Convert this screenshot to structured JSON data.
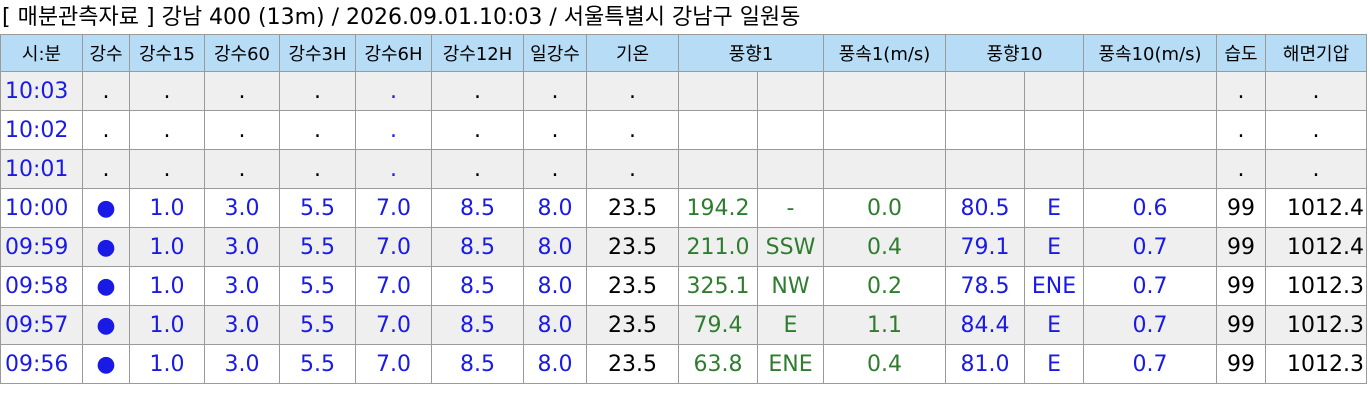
{
  "title": "[ 매분관측자료 ] 강남 400 (13m) / 2026.09.01.10:03 / 서울특별시 강남구 일원동",
  "headers": [
    "시:분",
    "강수",
    "강수15",
    "강수60",
    "강수3H",
    "강수6H",
    "강수12H",
    "일강수",
    "기온",
    "풍향1",
    "풍속1(m/s)",
    "풍향10",
    "풍속10(m/s)",
    "습도",
    "해면기압"
  ],
  "rows": [
    {
      "time": "10:03",
      "rain": ".",
      "r15": ".",
      "r60": ".",
      "r3h": ".",
      "r6h": ".",
      "r12h": ".",
      "day": ".",
      "temp": ".",
      "wd1": "",
      "wd1dir": "",
      "ws1": "",
      "wd10": "",
      "wd10dir": "",
      "ws10": "",
      "hum": ".",
      "press": "."
    },
    {
      "time": "10:02",
      "rain": ".",
      "r15": ".",
      "r60": ".",
      "r3h": ".",
      "r6h": ".",
      "r12h": ".",
      "day": ".",
      "temp": ".",
      "wd1": "",
      "wd1dir": "",
      "ws1": "",
      "wd10": "",
      "wd10dir": "",
      "ws10": "",
      "hum": ".",
      "press": "."
    },
    {
      "time": "10:01",
      "rain": ".",
      "r15": ".",
      "r60": ".",
      "r3h": ".",
      "r6h": ".",
      "r12h": ".",
      "day": ".",
      "temp": ".",
      "wd1": "",
      "wd1dir": "",
      "ws1": "",
      "wd10": "",
      "wd10dir": "",
      "ws10": "",
      "hum": ".",
      "press": "."
    },
    {
      "time": "10:00",
      "rain": "●",
      "r15": "1.0",
      "r60": "3.0",
      "r3h": "5.5",
      "r6h": "7.0",
      "r12h": "8.5",
      "day": "8.0",
      "temp": "23.5",
      "wd1": "194.2",
      "wd1dir": "-",
      "ws1": "0.0",
      "wd10": "80.5",
      "wd10dir": "E",
      "ws10": "0.6",
      "hum": "99",
      "press": "1012.4"
    },
    {
      "time": "09:59",
      "rain": "●",
      "r15": "1.0",
      "r60": "3.0",
      "r3h": "5.5",
      "r6h": "7.0",
      "r12h": "8.5",
      "day": "8.0",
      "temp": "23.5",
      "wd1": "211.0",
      "wd1dir": "SSW",
      "ws1": "0.4",
      "wd10": "79.1",
      "wd10dir": "E",
      "ws10": "0.7",
      "hum": "99",
      "press": "1012.4"
    },
    {
      "time": "09:58",
      "rain": "●",
      "r15": "1.0",
      "r60": "3.0",
      "r3h": "5.5",
      "r6h": "7.0",
      "r12h": "8.5",
      "day": "8.0",
      "temp": "23.5",
      "wd1": "325.1",
      "wd1dir": "NW",
      "ws1": "0.2",
      "wd10": "78.5",
      "wd10dir": "ENE",
      "ws10": "0.7",
      "hum": "99",
      "press": "1012.3"
    },
    {
      "time": "09:57",
      "rain": "●",
      "r15": "1.0",
      "r60": "3.0",
      "r3h": "5.5",
      "r6h": "7.0",
      "r12h": "8.5",
      "day": "8.0",
      "temp": "23.5",
      "wd1": "79.4",
      "wd1dir": "E",
      "ws1": "1.1",
      "wd10": "84.4",
      "wd10dir": "E",
      "ws10": "0.7",
      "hum": "99",
      "press": "1012.3"
    },
    {
      "time": "09:56",
      "rain": "●",
      "r15": "1.0",
      "r60": "3.0",
      "r3h": "5.5",
      "r6h": "7.0",
      "r12h": "8.5",
      "day": "8.0",
      "temp": "23.5",
      "wd1": "63.8",
      "wd1dir": "ENE",
      "ws1": "0.4",
      "wd10": "81.0",
      "wd10dir": "E",
      "ws10": "0.7",
      "hum": "99",
      "press": "1012.3"
    }
  ]
}
